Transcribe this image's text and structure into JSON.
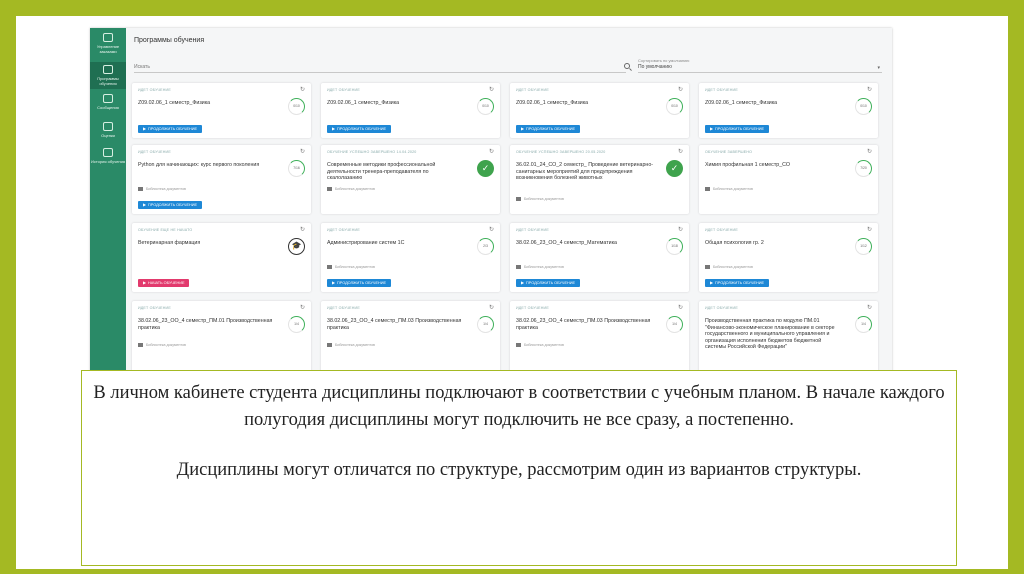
{
  "sidebar": {
    "items": [
      {
        "label": "Управление заказами",
        "icon": "orders-icon"
      },
      {
        "label": "Программы обучения",
        "icon": "courses-icon"
      },
      {
        "label": "Сообщения",
        "icon": "mail-icon"
      },
      {
        "label": "Оценки",
        "icon": "grades-icon"
      },
      {
        "label": "История обучения",
        "icon": "history-icon"
      }
    ]
  },
  "header": {
    "title": "Программы обучения"
  },
  "search": {
    "placeholder": "Искать"
  },
  "sort": {
    "label": "Сортировать по умолчанию",
    "value": "По умолчанию"
  },
  "cards": [
    {
      "status": "ИДЕТ ОБУЧЕНИЕ",
      "title": "Z09.02.06_1 семестр_Физика",
      "progress": "0/10",
      "button": "ПРОДОЛЖИТЬ ОБУЧЕНИЕ",
      "library": ""
    },
    {
      "status": "ИДЕТ ОБУЧЕНИЕ",
      "title": "Z09.02.06_1 семестр_Физика",
      "progress": "0/10",
      "button": "ПРОДОЛЖИТЬ ОБУЧЕНИЕ",
      "library": ""
    },
    {
      "status": "ИДЕТ ОБУЧЕНИЕ",
      "title": "Z09.02.06_1 семестр_Физика",
      "progress": "0/10",
      "button": "ПРОДОЛЖИТЬ ОБУЧЕНИЕ",
      "library": ""
    },
    {
      "status": "ИДЕТ ОБУЧЕНИЕ",
      "title": "Z09.02.06_1 семестр_Физика",
      "progress": "0/10",
      "button": "ПРОДОЛЖИТЬ ОБУЧЕНИЕ",
      "library": ""
    },
    {
      "status": "ИДЕТ ОБУЧЕНИЕ",
      "title": "Python для начинающих: курс первого поколения",
      "progress": "7/16",
      "button": "ПРОДОЛЖИТЬ ОБУЧЕНИЕ",
      "library": "Библиотека документов"
    },
    {
      "status": "ОБУЧЕНИЕ УСПЕШНО ЗАВЕРШЕНО 14.04.2020",
      "title": "Современные методики профессиональной деятельности тренера-преподавателя по скалолазанию",
      "progress": "",
      "button": "",
      "library": "Библиотека документов"
    },
    {
      "status": "ОБУЧЕНИЕ УСПЕШНО ЗАВЕРШЕНО 20.05.2020",
      "title": "36.02.01_24_СО_2 семестр_ Проведение ветеринарно-санитарных мероприятий для предупреждения возникновения болезней животных",
      "progress": "",
      "button": "",
      "library": "Библиотека документов"
    },
    {
      "status": "ОБУЧЕНИЕ ЗАВЕРШЕНО",
      "title": "Химия профильная 1 семестр_СО",
      "progress": "7/20",
      "button": "",
      "library": "Библиотека документов"
    },
    {
      "status": "ОБУЧЕНИЕ ЕЩЕ НЕ НАЧАТО",
      "title": "Ветеринарная фармация",
      "progress": "",
      "button": "НАЧАТЬ ОБУЧЕНИЕ",
      "library": ""
    },
    {
      "status": "ИДЕТ ОБУЧЕНИЕ",
      "title": "Администрирование систем 1С",
      "progress": "2/3",
      "button": "ПРОДОЛЖИТЬ ОБУЧЕНИЕ",
      "library": "Библиотека документов"
    },
    {
      "status": "ИДЕТ ОБУЧЕНИЕ",
      "title": "38.02.06_23_ОО_4 семестр_Математика",
      "progress": "1/18",
      "button": "ПРОДОЛЖИТЬ ОБУЧЕНИЕ",
      "library": "Библиотека документов"
    },
    {
      "status": "ИДЕТ ОБУЧЕНИЕ",
      "title": "Общая психология гр. 2",
      "progress": "1/12",
      "button": "ПРОДОЛЖИТЬ ОБУЧЕНИЕ",
      "library": "Библиотека документов"
    },
    {
      "status": "ИДЕТ ОБУЧЕНИЕ",
      "title": "38.02.06_23_ОО_4 семестр_ПМ.01 Производственная практика",
      "progress": "1/4",
      "button": "",
      "library": "Библиотека документов"
    },
    {
      "status": "ИДЕТ ОБУЧЕНИЕ",
      "title": "38.02.06_23_ОО_4 семестр_ПМ.03 Производственная практика",
      "progress": "1/4",
      "button": "",
      "library": "Библиотека документов"
    },
    {
      "status": "ИДЕТ ОБУЧЕНИЕ",
      "title": "38.02.06_23_ОО_4 семестр_ПМ.03 Производственная практика",
      "progress": "1/4",
      "button": "",
      "library": "Библиотека документов"
    },
    {
      "status": "ИДЕТ ОБУЧЕНИЕ",
      "title": "Производственная практика по модулю ПМ.01 \"Финансово-экономическое планирование в секторе государственного и муниципального управления и организация исполнения бюджетов бюджетной системы Российской Федерации\"",
      "progress": "1/4",
      "button": "",
      "library": ""
    }
  ],
  "caption": {
    "paragraph1": "В личном кабинете студента дисциплины подключают в соответствии с учебным планом. В начале каждого полугодия дисциплины могут подключить не все сразу, а постепенно.",
    "paragraph2": "Дисциплины могут отличатся по структуре, рассмотрим один из вариантов структуры."
  },
  "colors": {
    "frame": "#a4b923",
    "sidebar": "#2a8a67",
    "button_blue": "#1e88d6",
    "button_red": "#e23a6d",
    "done_green": "#3fa34d"
  }
}
